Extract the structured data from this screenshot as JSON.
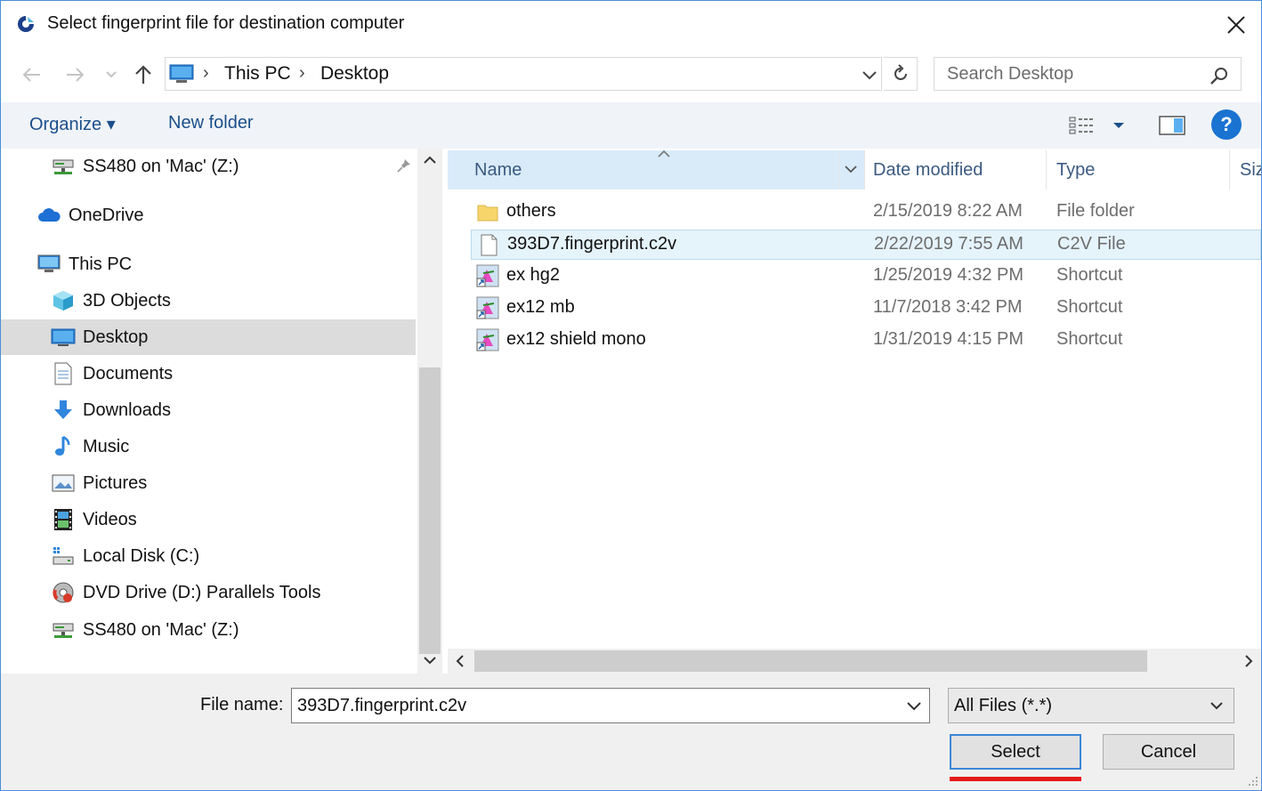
{
  "window": {
    "title": "Select fingerprint file for destination computer",
    "close_glyph": "✕"
  },
  "address": {
    "crumbs": [
      "This PC",
      "Desktop"
    ],
    "search_placeholder": "Search Desktop"
  },
  "toolbar": {
    "organize": "Organize ▾",
    "new_folder": "New folder",
    "help": "?"
  },
  "nav": {
    "items": [
      {
        "label": "SS480 on 'Mac' (Z:)",
        "icon": "network-drive-icon"
      },
      {
        "label": "OneDrive",
        "icon": "cloud-icon"
      },
      {
        "label": "This PC",
        "icon": "computer-icon"
      },
      {
        "label": "3D Objects",
        "icon": "cube-icon"
      },
      {
        "label": "Desktop",
        "icon": "desktop-icon"
      },
      {
        "label": "Documents",
        "icon": "document-icon"
      },
      {
        "label": "Downloads",
        "icon": "download-arrow-icon"
      },
      {
        "label": "Music",
        "icon": "music-note-icon"
      },
      {
        "label": "Pictures",
        "icon": "pictures-icon"
      },
      {
        "label": "Videos",
        "icon": "film-icon"
      },
      {
        "label": "Local Disk (C:)",
        "icon": "local-disk-icon"
      },
      {
        "label": "DVD Drive (D:) Parallels Tools",
        "icon": "dvd-drive-icon"
      },
      {
        "label": "SS480 on 'Mac' (Z:)",
        "icon": "network-drive-icon"
      }
    ],
    "selected": "Desktop"
  },
  "columns": {
    "name": "Name",
    "date": "Date modified",
    "type": "Type",
    "size": "Siz"
  },
  "files": [
    {
      "name": "others",
      "date": "2/15/2019 8:22 AM",
      "type": "File folder",
      "icon": "folder-icon"
    },
    {
      "name": "393D7.fingerprint.c2v",
      "date": "2/22/2019 7:55 AM",
      "type": "C2V File",
      "icon": "file-icon"
    },
    {
      "name": "ex hg2",
      "date": "1/25/2019 4:32 PM",
      "type": "Shortcut",
      "icon": "shortcut-icon"
    },
    {
      "name": "ex12 mb",
      "date": "11/7/2018 3:42 PM",
      "type": "Shortcut",
      "icon": "shortcut-icon"
    },
    {
      "name": "ex12 shield mono",
      "date": "1/31/2019 4:15 PM",
      "type": "Shortcut",
      "icon": "shortcut-icon"
    }
  ],
  "selected_file": "393D7.fingerprint.c2v",
  "footer": {
    "file_name_label": "File name:",
    "file_name_value": "393D7.fingerprint.c2v",
    "filter": "All Files (*.*)",
    "select_label": "Select",
    "cancel_label": "Cancel"
  },
  "colors": {
    "accent": "#1a73d1",
    "selection_bg": "#e5f3fb",
    "highlight_underline": "#e41b1b"
  }
}
